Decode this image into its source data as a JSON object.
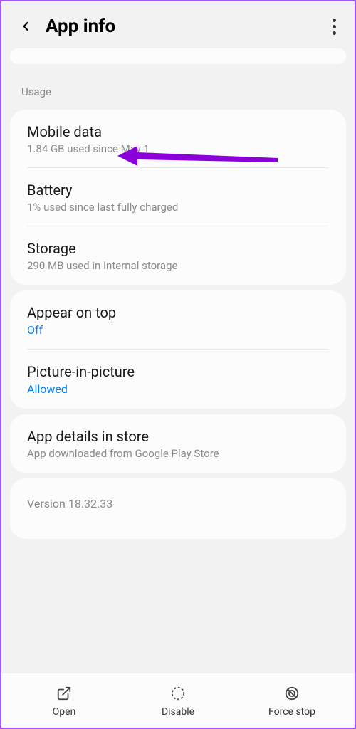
{
  "header": {
    "title": "App info"
  },
  "sections": {
    "usage_label": "Usage"
  },
  "usage": {
    "mobile_data": {
      "title": "Mobile data",
      "sub": "1.84 GB used since May 1"
    },
    "battery": {
      "title": "Battery",
      "sub": "1% used since last fully charged"
    },
    "storage": {
      "title": "Storage",
      "sub": "290 MB used in Internal storage"
    }
  },
  "overlay": {
    "appear_on_top": {
      "title": "Appear on top",
      "sub": "Off"
    },
    "pip": {
      "title": "Picture-in-picture",
      "sub": "Allowed"
    }
  },
  "store": {
    "title": "App details in store",
    "sub": "App downloaded from Google Play Store"
  },
  "version": "Version 18.32.33",
  "actions": {
    "open": "Open",
    "disable": "Disable",
    "force_stop": "Force stop"
  },
  "colors": {
    "accent_arrow": "#8b00d9"
  }
}
